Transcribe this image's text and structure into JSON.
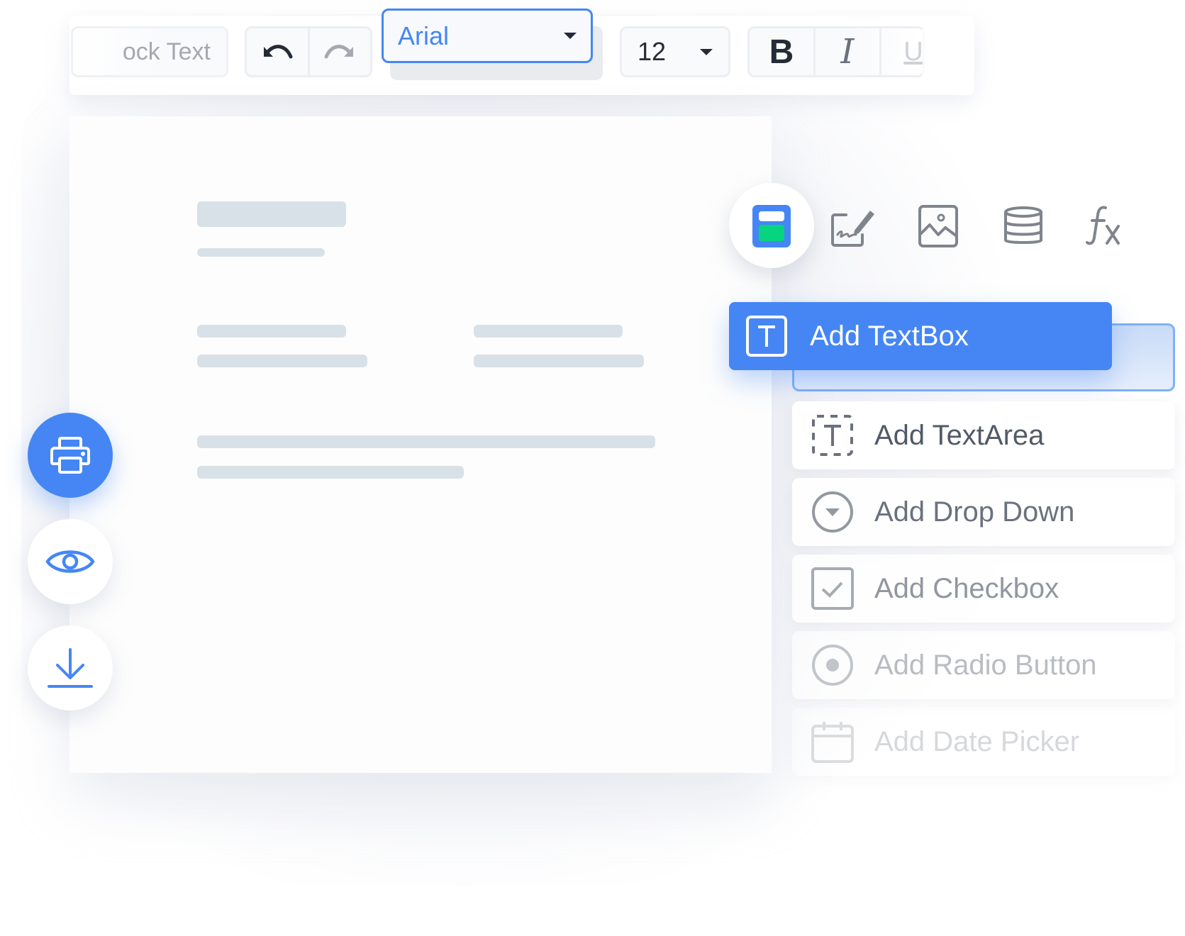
{
  "toolbar": {
    "lock_text_label": "ock Text",
    "undo_icon": "undo-icon",
    "redo_icon": "redo-icon",
    "font_family": {
      "value": "Arial",
      "icon": "caret-down-icon"
    },
    "font_size": {
      "value": "12",
      "icon": "caret-down-icon"
    },
    "format": {
      "bold": "B",
      "italic": "I",
      "underline": "U"
    }
  },
  "side_actions": [
    {
      "name": "print",
      "icon": "printer-icon",
      "active": true
    },
    {
      "name": "preview",
      "icon": "eye-icon",
      "active": false
    },
    {
      "name": "download",
      "icon": "download-icon",
      "active": false
    }
  ],
  "palette_tabs": [
    {
      "name": "form-fields",
      "icon": "form-fields-icon",
      "active": true
    },
    {
      "name": "signature",
      "icon": "signature-icon",
      "active": false
    },
    {
      "name": "image",
      "icon": "image-icon",
      "active": false
    },
    {
      "name": "database",
      "icon": "database-icon",
      "active": false
    },
    {
      "name": "formula",
      "icon": "formula-icon",
      "label": "fx",
      "active": false
    }
  ],
  "field_menu": {
    "active": {
      "label": "Add TextBox",
      "icon": "textbox-icon"
    },
    "items": [
      {
        "label": "Add TextArea",
        "icon": "textarea-icon"
      },
      {
        "label": "Add Drop Down",
        "icon": "dropdown-icon"
      },
      {
        "label": "Add Checkbox",
        "icon": "checkbox-icon"
      },
      {
        "label": "Add Radio Button",
        "icon": "radio-button-icon"
      },
      {
        "label": "Add Date Picker",
        "icon": "calendar-icon"
      }
    ]
  },
  "colors": {
    "accent": "#4586f4",
    "accent_green": "#07d47e",
    "text_dark": "#252b37",
    "text_muted": "#525a68",
    "placeholder_bar": "#d8e1e7"
  }
}
